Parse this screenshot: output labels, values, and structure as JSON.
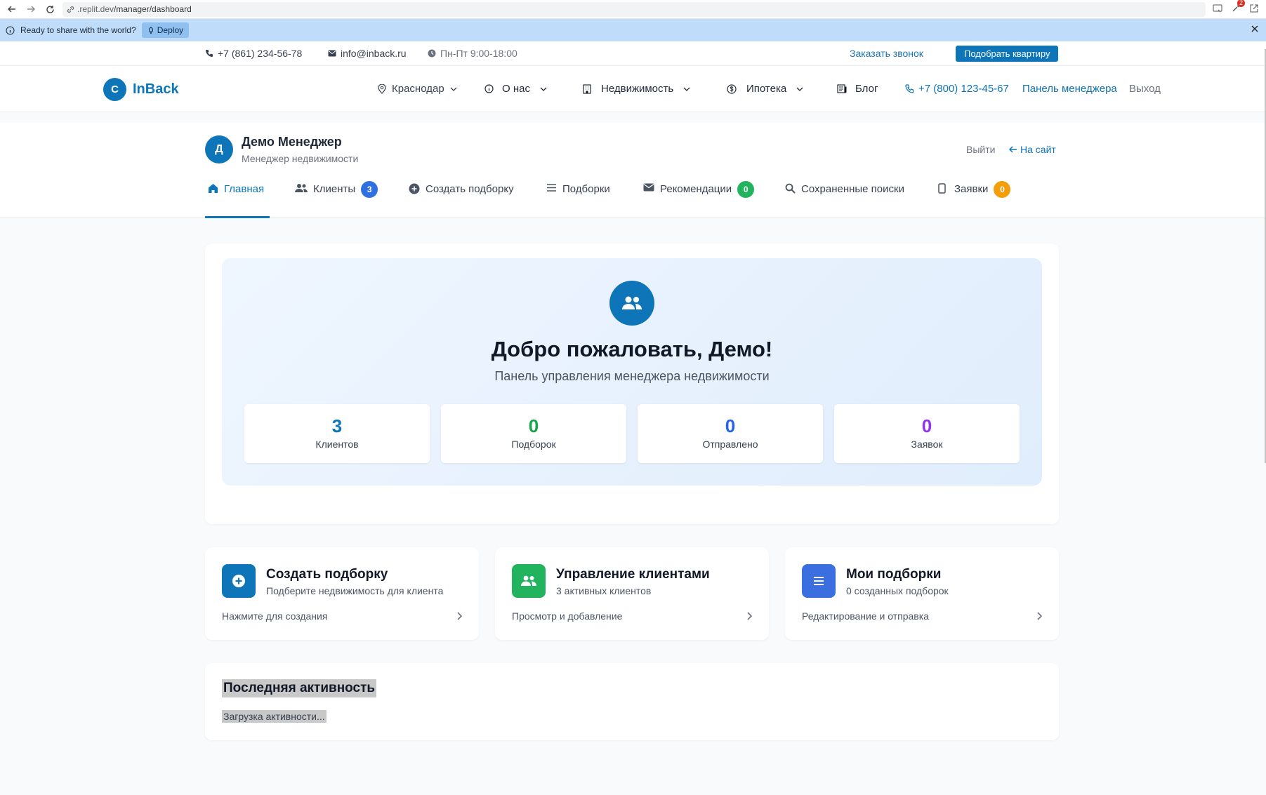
{
  "browser": {
    "url_prefix": ".replit.dev",
    "url_path": "/manager/dashboard",
    "ext_badge": "2"
  },
  "banner": {
    "text": "Ready to share with the world?",
    "deploy_label": "Deploy"
  },
  "topbar": {
    "phone": "+7 (861) 234-56-78",
    "email": "info@inback.ru",
    "hours": "Пн-Пт 9:00-18:00",
    "callback_label": "Заказать звонок",
    "pick_label": "Подобрать квартиру"
  },
  "nav": {
    "logo_letter": "C",
    "logo_text": "InBack",
    "city": "Краснодар",
    "about": "О нас",
    "realty": "Недвижимость",
    "mortgage": "Ипотека",
    "blog": "Блог",
    "phone": "+7 (800) 123-45-67",
    "manager_panel": "Панель менеджера",
    "logout": "Выход"
  },
  "manager": {
    "avatar_letter": "Д",
    "name": "Демо Менеджер",
    "role": "Менеджер недвижимости",
    "exit_label": "Выйти",
    "site_label": "На сайт"
  },
  "tabs": [
    {
      "label": "Главная"
    },
    {
      "label": "Клиенты",
      "badge": "3"
    },
    {
      "label": "Создать подборку"
    },
    {
      "label": "Подборки"
    },
    {
      "label": "Рекомендации",
      "badge": "0"
    },
    {
      "label": "Сохраненные поиски"
    },
    {
      "label": "Заявки",
      "badge": "0"
    }
  ],
  "welcome": {
    "title": "Добро пожаловать, Демо!",
    "subtitle": "Панель управления менеджера недвижимости",
    "stats": [
      {
        "value": "3",
        "label": "Клиентов",
        "color": "#0e76b8"
      },
      {
        "value": "0",
        "label": "Подборок",
        "color": "#16a34a"
      },
      {
        "value": "0",
        "label": "Отправлено",
        "color": "#2563eb"
      },
      {
        "value": "0",
        "label": "Заявок",
        "color": "#9333ea"
      }
    ]
  },
  "actions": [
    {
      "title": "Создать подборку",
      "desc": "Подберите недвижимость для клиента",
      "footer": "Нажмите для создания",
      "color": "#0e76b8",
      "icon": "plus-circle-icon"
    },
    {
      "title": "Управление клиентами",
      "desc": "3 активных клиентов",
      "footer": "Просмотр и добавление",
      "color": "#22b35e",
      "icon": "users-icon"
    },
    {
      "title": "Мои подборки",
      "desc": "0 созданных подборок",
      "footer": "Редактирование и отправка",
      "color": "#3b6fe0",
      "icon": "list-icon"
    }
  ],
  "activity": {
    "title": "Последняя активность",
    "loading": "Загрузка активности..."
  },
  "colors": {
    "brand": "#0e76b8",
    "badge_blue": "#2f6fe0",
    "badge_green": "#22b35e",
    "badge_orange": "#f59e0b"
  }
}
